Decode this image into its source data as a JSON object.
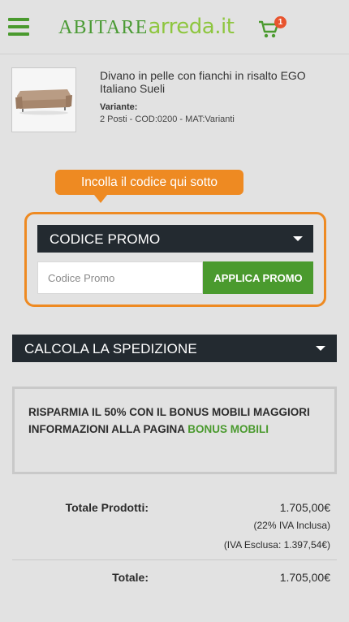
{
  "header": {
    "menu_icon": "hamburger-icon",
    "logo_part1": "ABITARE",
    "logo_part2": "arreda.it",
    "cart_icon": "cart-icon",
    "cart_count": "1"
  },
  "product": {
    "name": "Divano in pelle con fianchi in risalto EGO Italiano Sueli",
    "variant_label": "Variante:",
    "variant_value": "2 Posti - COD:0200 - MAT:Varianti"
  },
  "callout": {
    "text": "Incolla il codice qui sotto"
  },
  "promo": {
    "header_label": "CODICE PROMO",
    "placeholder": "Codice Promo",
    "value": "",
    "apply_label": "APPLICA PROMO"
  },
  "shipping": {
    "header_label": "CALCOLA LA SPEDIZIONE"
  },
  "info": {
    "text": "RISPARMIA IL 50% CON IL BONUS MOBILI MAGGIORI INFORMAZIONI ALLA PAGINA ",
    "link": "BONUS MOBILI"
  },
  "totals": {
    "products_label": "Totale Prodotti:",
    "products_value": "1.705,00€",
    "vat_included": "(22% IVA Inclusa)",
    "vat_excluded": "(IVA Esclusa: 1.397,54€)",
    "total_label": "Totale:",
    "total_value": "1.705,00€"
  },
  "colors": {
    "brand_green": "#4a9a2e",
    "accent_orange": "#ee8a22",
    "dark_bar": "#232a30",
    "badge_red": "#e8542e"
  }
}
